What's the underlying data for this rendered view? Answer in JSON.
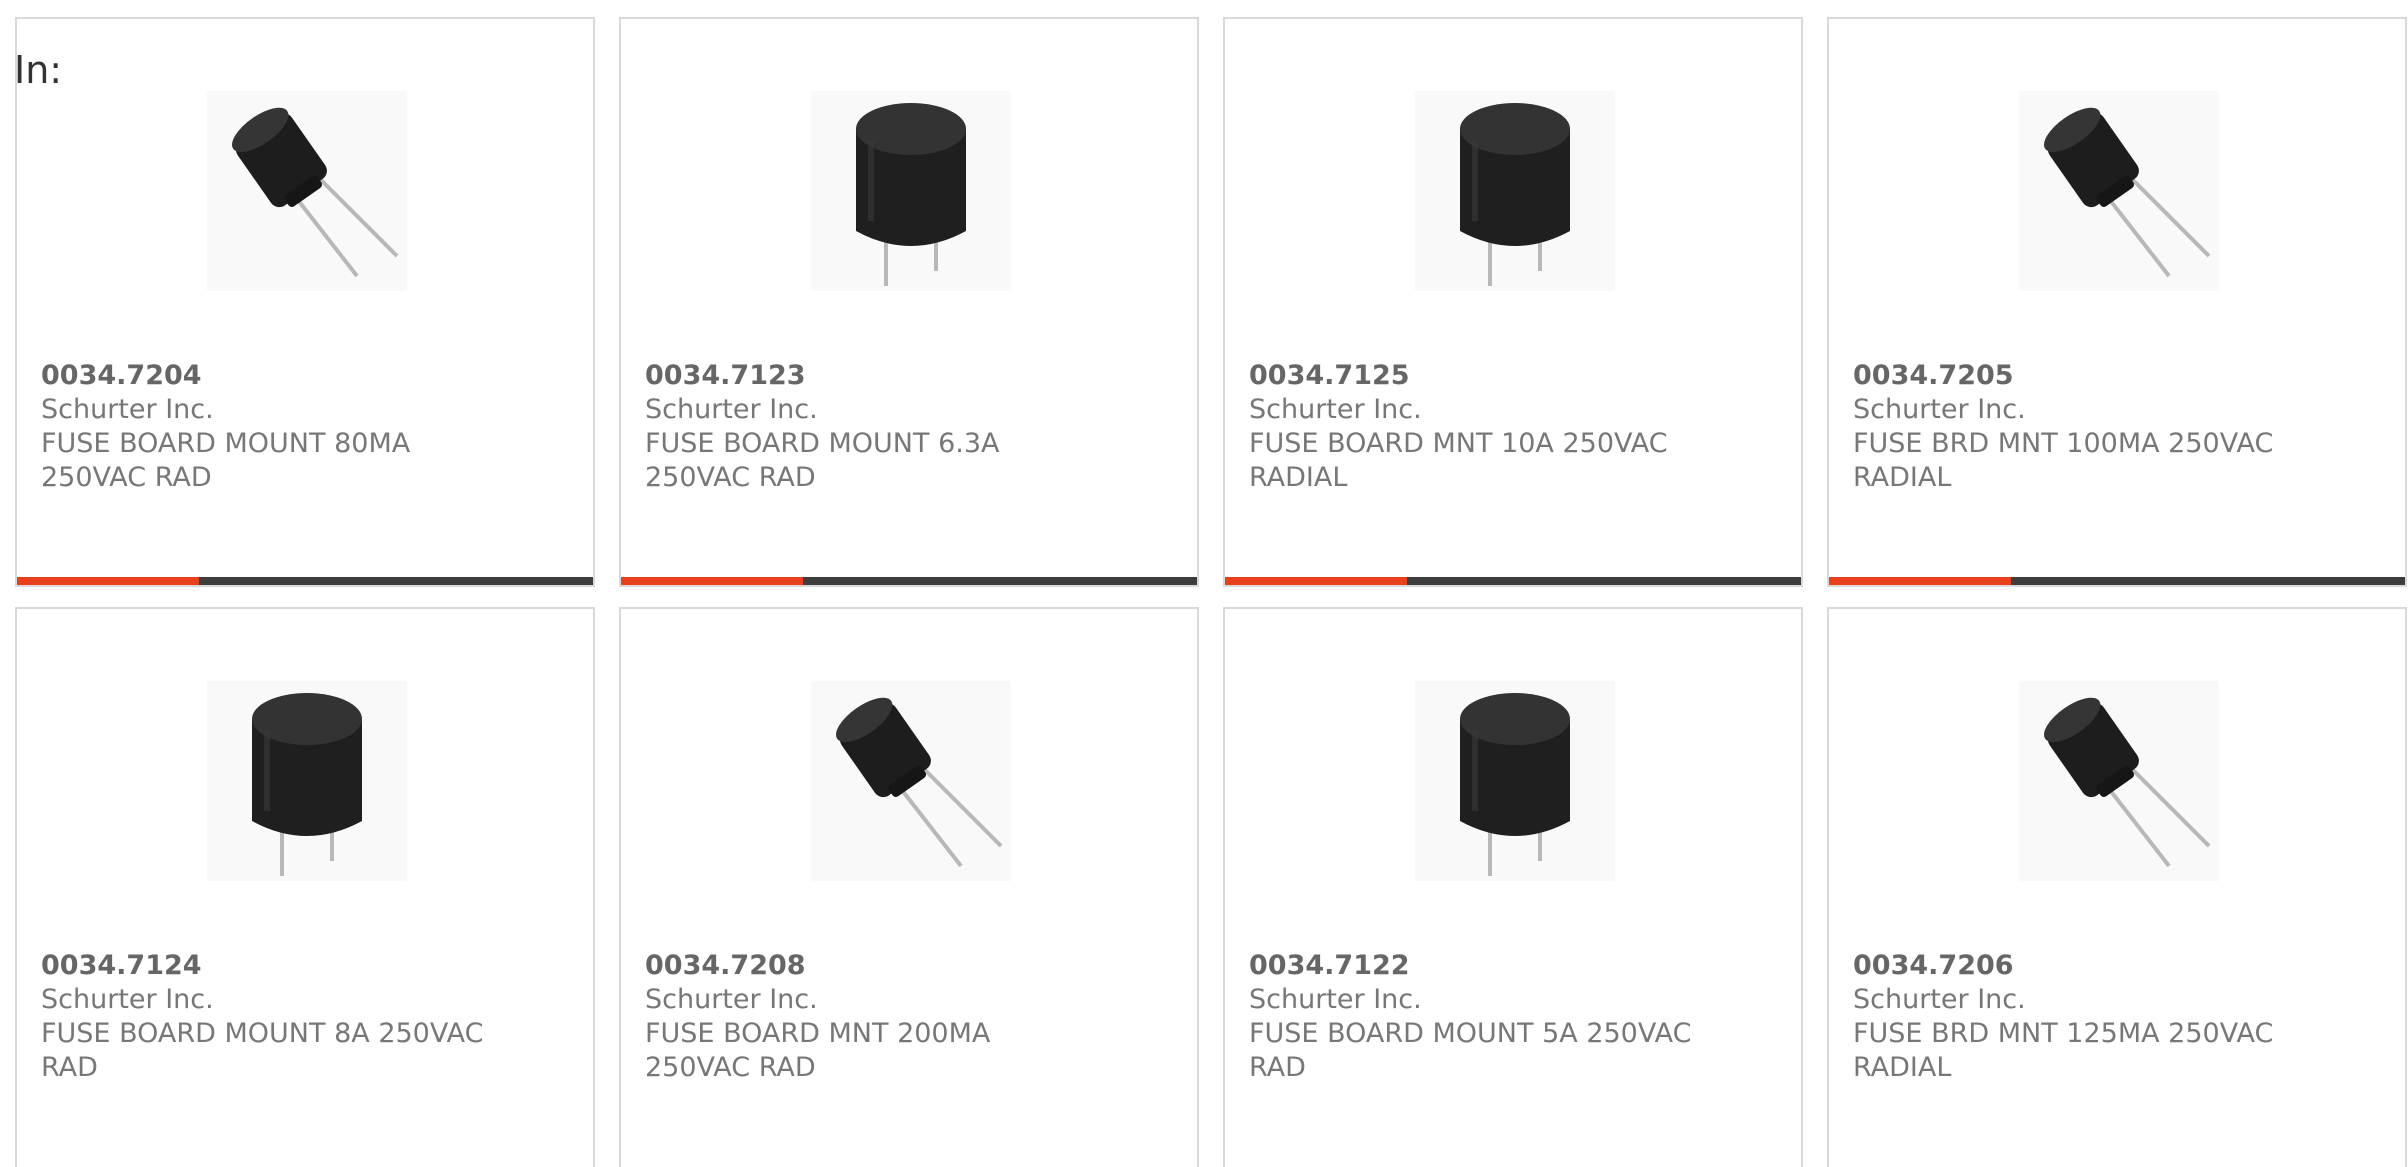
{
  "header": {
    "in_label": "In:"
  },
  "colors": {
    "accent": "#e8401c",
    "bar": "#3d3d3d"
  },
  "products": [
    {
      "part_number": "0034.7204",
      "manufacturer": "Schurter Inc.",
      "description": "FUSE BOARD MOUNT 80MA 250VAC RAD",
      "image_icon": "fuse-angled-icon"
    },
    {
      "part_number": "0034.7123",
      "manufacturer": "Schurter Inc.",
      "description": "FUSE BOARD MOUNT 6.3A 250VAC RAD",
      "image_icon": "fuse-upright-icon"
    },
    {
      "part_number": "0034.7125",
      "manufacturer": "Schurter Inc.",
      "description": "FUSE BOARD MNT 10A 250VAC RADIAL",
      "image_icon": "fuse-upright-icon"
    },
    {
      "part_number": "0034.7205",
      "manufacturer": "Schurter Inc.",
      "description": "FUSE BRD MNT 100MA 250VAC RADIAL",
      "image_icon": "fuse-angled-icon"
    },
    {
      "part_number": "0034.7124",
      "manufacturer": "Schurter Inc.",
      "description": "FUSE BOARD MOUNT 8A 250VAC RAD",
      "image_icon": "fuse-upright-icon"
    },
    {
      "part_number": "0034.7208",
      "manufacturer": "Schurter Inc.",
      "description": "FUSE BOARD MNT 200MA 250VAC RAD",
      "image_icon": "fuse-angled-icon"
    },
    {
      "part_number": "0034.7122",
      "manufacturer": "Schurter Inc.",
      "description": "FUSE BOARD MOUNT 5A 250VAC RAD",
      "image_icon": "fuse-upright-icon"
    },
    {
      "part_number": "0034.7206",
      "manufacturer": "Schurter Inc.",
      "description": "FUSE BRD MNT 125MA 250VAC RADIAL",
      "image_icon": "fuse-angled-icon"
    }
  ]
}
